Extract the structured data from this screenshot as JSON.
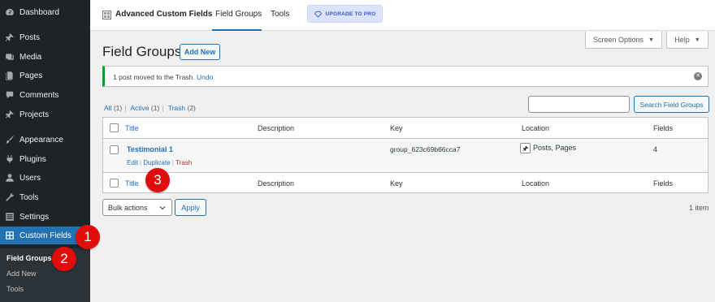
{
  "sidebar": {
    "items": [
      {
        "label": "Dashboard",
        "icon": "dashboard-icon"
      },
      {
        "label": "Posts",
        "icon": "pin-icon"
      },
      {
        "label": "Media",
        "icon": "media-icon"
      },
      {
        "label": "Pages",
        "icon": "page-icon"
      },
      {
        "label": "Comments",
        "icon": "comment-icon"
      },
      {
        "label": "Projects",
        "icon": "pin-icon"
      },
      {
        "label": "Appearance",
        "icon": "brush-icon"
      },
      {
        "label": "Plugins",
        "icon": "plugin-icon"
      },
      {
        "label": "Users",
        "icon": "user-icon"
      },
      {
        "label": "Tools",
        "icon": "wrench-icon"
      },
      {
        "label": "Settings",
        "icon": "settings-icon"
      },
      {
        "label": "Custom Fields",
        "icon": "custom-fields-icon"
      }
    ],
    "submenu": [
      "Field Groups",
      "Add New",
      "Tools"
    ]
  },
  "badges": [
    "1",
    "2",
    "3"
  ],
  "topbar": {
    "title": "Advanced Custom Fields",
    "tabs": [
      "Field Groups",
      "Tools"
    ],
    "upgrade_label": "UPGRADE TO PRO"
  },
  "screen_options": "Screen Options",
  "help": "Help",
  "page": {
    "title": "Field Groups",
    "add_new": "Add New"
  },
  "notice": {
    "text": "1 post moved to the Trash.",
    "undo": "Undo"
  },
  "filters": {
    "all": "All",
    "all_count": "(1)",
    "active": "Active",
    "active_count": "(1)",
    "trash": "Trash",
    "trash_count": "(2)"
  },
  "search": {
    "value": "",
    "button": "Search Field Groups"
  },
  "table": {
    "columns": [
      "Title",
      "Description",
      "Key",
      "Location",
      "Fields"
    ],
    "rows": [
      {
        "title": "Testimonial 1",
        "description": "",
        "key": "group_623c69b66cca7",
        "location": "Posts, Pages",
        "fields": "4",
        "actions": [
          "Edit",
          "Duplicate",
          "Trash"
        ]
      }
    ]
  },
  "bulk": {
    "selected": "Bulk actions",
    "apply": "Apply"
  },
  "item_count": "1 item",
  "colors": {
    "sidebar_bg": "#1d2327",
    "active_bg": "#2271b1",
    "link": "#2271b1",
    "notice_border": "#00a32a",
    "badge": "#e10c0c"
  }
}
